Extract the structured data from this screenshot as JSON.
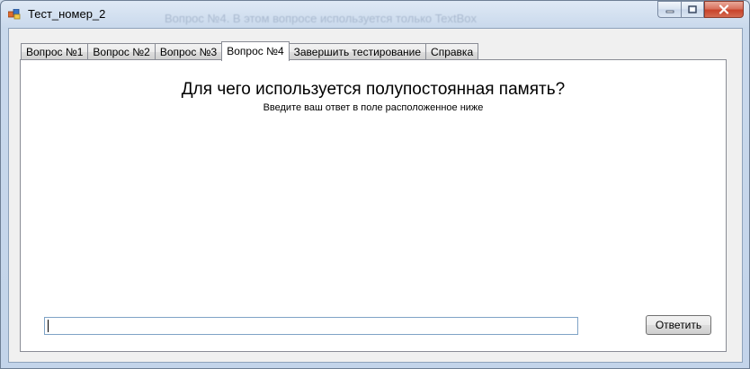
{
  "window": {
    "title": "Тест_номер_2",
    "ghost_title": "Вопрос №4. В этом вопросе используется только TextBox"
  },
  "tabs": [
    {
      "label": "Вопрос №1",
      "active": false
    },
    {
      "label": "Вопрос №2",
      "active": false
    },
    {
      "label": "Вопрос №3",
      "active": false
    },
    {
      "label": "Вопрос №4",
      "active": true
    },
    {
      "label": "Завершить тестирование",
      "active": false
    },
    {
      "label": "Справка",
      "active": false
    }
  ],
  "content": {
    "question": "Для чего используется полупостоянная память?",
    "hint": "Введите ваш ответ в поле расположенное ниже",
    "answer_value": "",
    "answer_button": "Ответить"
  },
  "colors": {
    "frame": "#c3d4ea",
    "close_button": "#c8432a",
    "page_background": "#ffffff"
  }
}
